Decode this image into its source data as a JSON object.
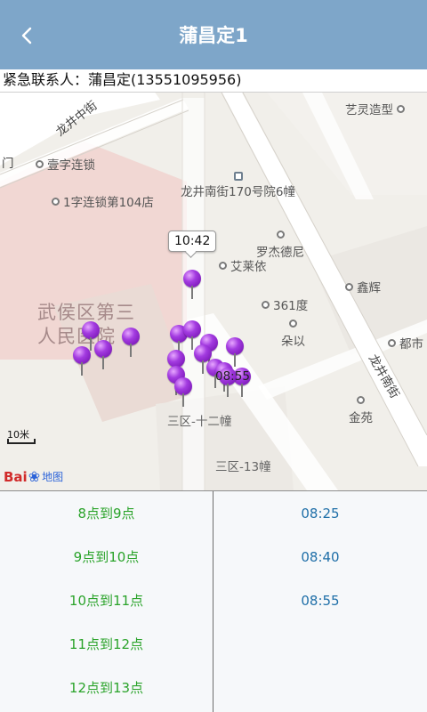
{
  "navbar": {
    "title": "蒲昌定1",
    "back_icon": "chevron-left-icon"
  },
  "contact": {
    "text": "紧急联系人：蒲昌定(13551095956)"
  },
  "map": {
    "roads": [
      "龙井中街",
      "龙井南街"
    ],
    "areas": [
      "武侯区第三人民医院"
    ],
    "pois": [
      "艺灵造型",
      "壹字连锁",
      "龙井南街170号院6幢",
      "1字连锁第104店",
      "罗杰德尼",
      "艾莱依",
      "鑫辉",
      "361度",
      "朵以",
      "都市",
      "金苑",
      "三区-十二幢",
      "三区-13幢"
    ],
    "door_label": "门",
    "callout_time": "10:42",
    "pin_time_label": "08:55",
    "pin_count": 17,
    "scale_label": "10米",
    "logo": {
      "bai": "Bai",
      "du_map": "地图"
    }
  },
  "schedule": {
    "ranges": [
      "8点到9点",
      "9点到10点",
      "10点到11点",
      "11点到12点",
      "12点到13点"
    ],
    "times": [
      "08:25",
      "08:40",
      "08:55"
    ]
  },
  "colors": {
    "navbar": "#7ea6c9",
    "range_text": "#2aa32a",
    "time_text": "#1f6fa8",
    "pin": "#9b2ee0"
  }
}
